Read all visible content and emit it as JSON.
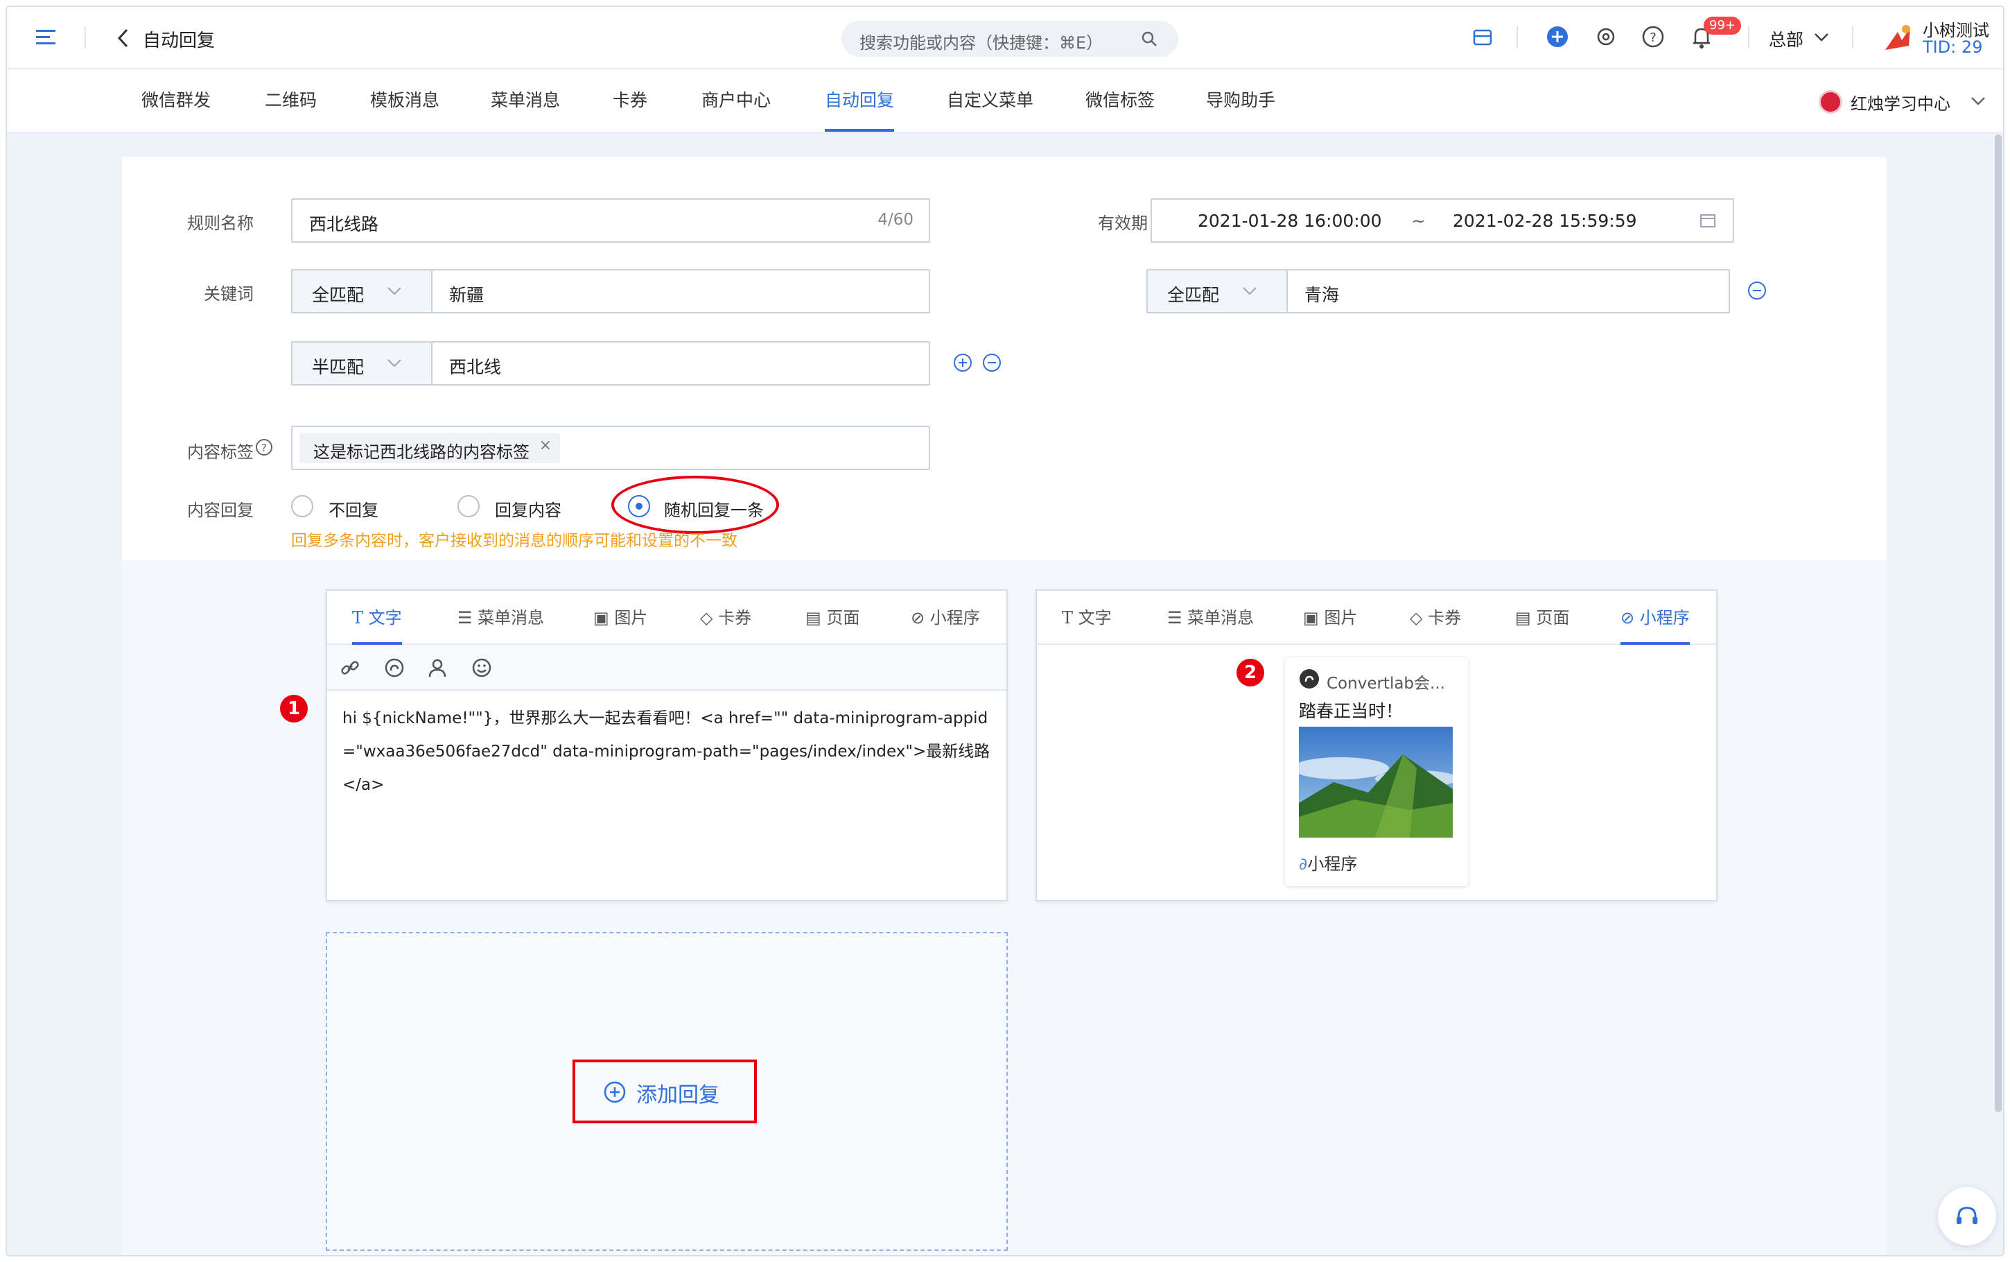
{
  "header": {
    "page_title": "自动回复",
    "search_placeholder": "搜索功能或内容（快捷键：⌘E）",
    "notification_count": "99+",
    "org": "总部",
    "user_name": "小树测试",
    "user_tid": "TID: 29"
  },
  "nav": {
    "tabs": [
      "微信群发",
      "二维码",
      "模板消息",
      "菜单消息",
      "卡券",
      "商户中心",
      "自动回复",
      "自定义菜单",
      "微信标签",
      "导购助手"
    ],
    "active": "自动回复",
    "account": "红烛学习中心"
  },
  "form": {
    "rule_name_label": "规则名称",
    "rule_name_value": "西北线路",
    "rule_name_count": "4/60",
    "validity_label": "有效期",
    "start": "2021-01-28 16:00:00",
    "sep": "~",
    "end": "2021-02-28 15:59:59",
    "keyword_label": "关键词",
    "keywords": [
      {
        "match": "全匹配",
        "value": "新疆"
      },
      {
        "match": "全匹配",
        "value": "青海"
      },
      {
        "match": "半匹配",
        "value": "西北线"
      }
    ],
    "content_tag_label": "内容标签",
    "content_tag": "这是标记西北线路的内容标签",
    "content_reply_label": "内容回复",
    "reply_options": [
      "不回复",
      "回复内容",
      "随机回复一条"
    ],
    "reply_selected": "随机回复一条",
    "warning": "回复多条内容时，客户接收到的消息的顺序可能和设置的不一致"
  },
  "editor": {
    "tabs": [
      "文字",
      "菜单消息",
      "图片",
      "卡券",
      "页面",
      "小程序"
    ],
    "left_active": "文字",
    "right_active": "小程序",
    "text_content": "hi ${nickName!\"\"}，世界那么大一起去看看吧！<a href=\"\" data-miniprogram-appid=\"wxaa36e506fae27dcd\" data-miniprogram-path=\"pages/index/index\">最新线路</a>",
    "marker1": "1",
    "marker2": "2",
    "mini_card": {
      "source": "Convertlab会...",
      "title": "踏春正当时！",
      "footer": "小程序"
    },
    "add_reply": "添加回复"
  },
  "colors": {
    "accent": "#2f6fd8",
    "warning": "#f0a020",
    "annotation": "#e60012"
  }
}
